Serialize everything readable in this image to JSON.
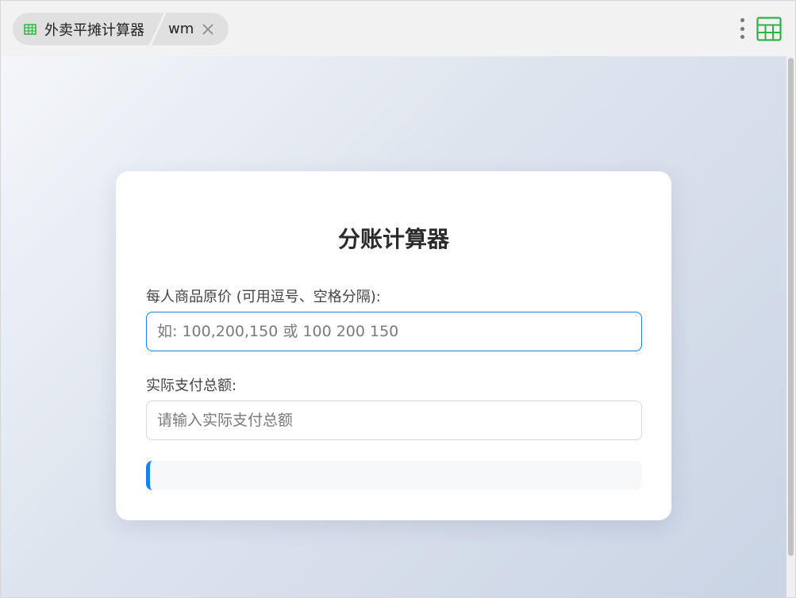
{
  "tabs": [
    {
      "label": "外卖平摊计算器",
      "icon": "spreadsheet-icon"
    },
    {
      "label": "wm",
      "close_icon": "close-icon"
    }
  ],
  "toolbar": {
    "more_icon": "kebab-menu-icon",
    "app_icon": "spreadsheet-icon"
  },
  "colors": {
    "accent": "#1a80ea",
    "icon_green": "#2fb344"
  },
  "form": {
    "title": "分账计算器",
    "prices_label": "每人商品原价 (可用逗号、空格分隔):",
    "prices_placeholder": "如: 100,200,150 或 100 200 150",
    "prices_value": "",
    "total_label": "实际支付总额:",
    "total_placeholder": "请输入实际支付总额",
    "total_value": ""
  },
  "result": {
    "text": ""
  }
}
